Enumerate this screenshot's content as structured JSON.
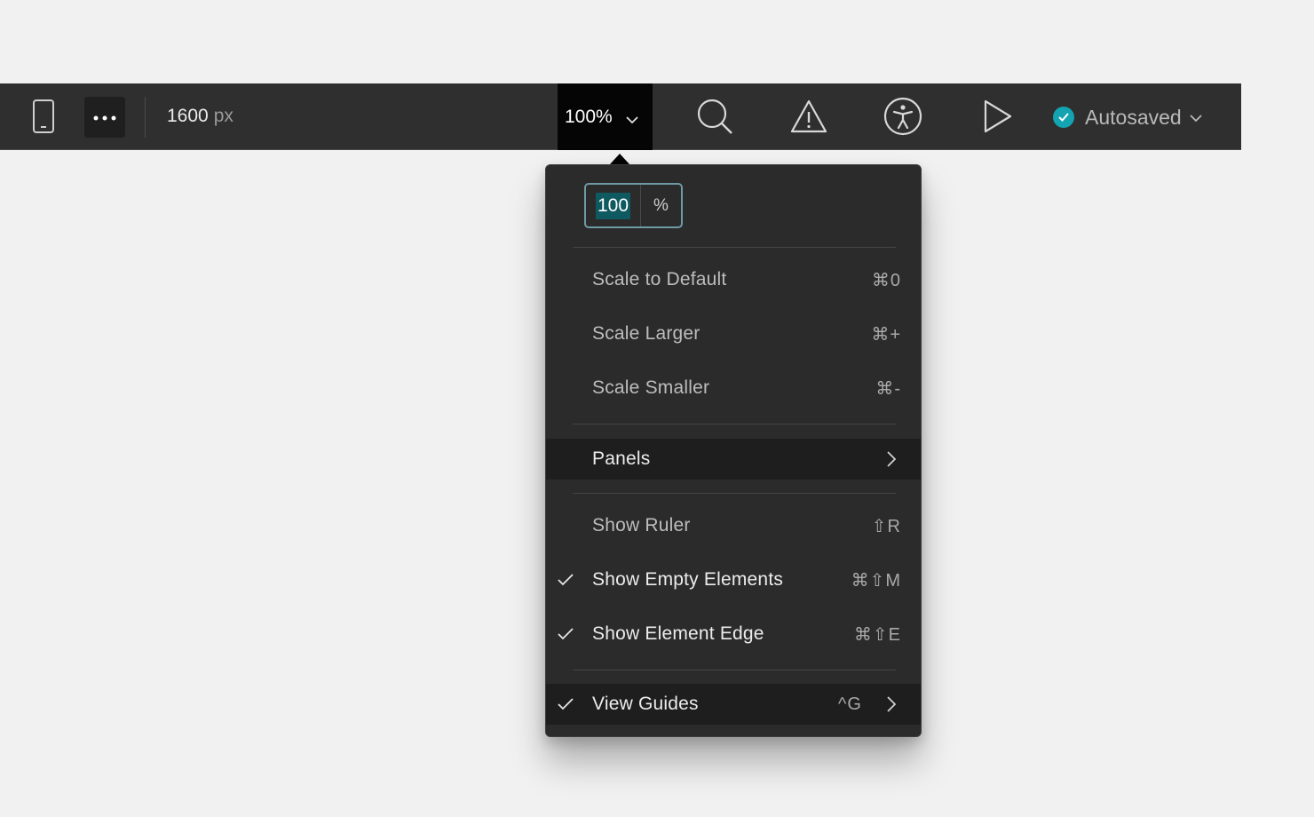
{
  "toolbar": {
    "device_icon": "mobile-phone-icon",
    "more_icon": "more-horizontal-icon",
    "width_value": "1600",
    "width_unit": "px",
    "zoom_label": "100%",
    "search_icon": "search-icon",
    "warning_icon": "warning-icon",
    "accessibility_icon": "accessibility-icon",
    "play_icon": "play-icon",
    "autosave_label": "Autosaved",
    "autosave_color": "#14a3b0"
  },
  "zoom_menu": {
    "input_value": "100",
    "input_unit": "%",
    "items": [
      {
        "label": "Scale to Default",
        "shortcut": "⌘0",
        "checked": false
      },
      {
        "label": "Scale Larger",
        "shortcut": "⌘+",
        "checked": false
      },
      {
        "label": "Scale Smaller",
        "shortcut": "⌘-",
        "checked": false
      },
      {
        "label": "Panels",
        "shortcut": "",
        "checked": false,
        "submenu": true,
        "highlighted": true
      },
      {
        "label": "Show Ruler",
        "shortcut": "⇧R",
        "checked": false
      },
      {
        "label": "Show Empty Elements",
        "shortcut": "⌘⇧M",
        "checked": true
      },
      {
        "label": "Show Element Edge",
        "shortcut": "⌘⇧E",
        "checked": true
      },
      {
        "label": "View Guides",
        "shortcut": "^G",
        "checked": true,
        "submenu": true,
        "highlighted": true
      }
    ]
  }
}
